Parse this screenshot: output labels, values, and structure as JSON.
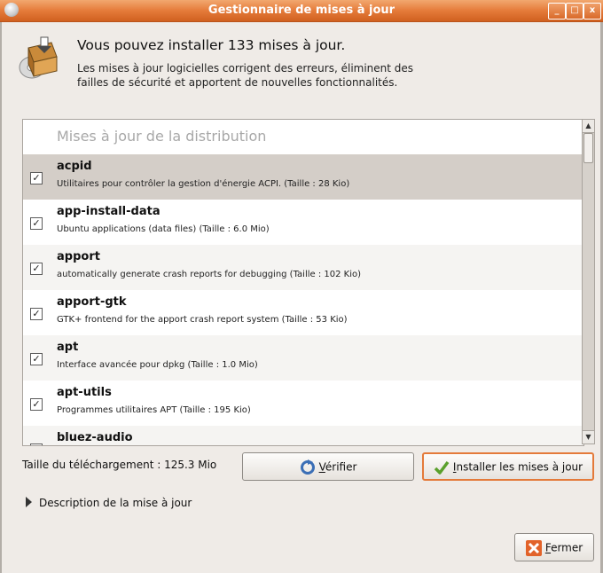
{
  "window": {
    "title": "Gestionnaire de mises à jour"
  },
  "header": {
    "title": "Vous pouvez installer 133 mises à jour.",
    "description": "Les mises à jour logicielles corrigent des erreurs, éliminent des failles de sécurité et apportent de nouvelles fonctionnalités."
  },
  "list": {
    "section_title": "Mises à jour de la distribution",
    "items": [
      {
        "name": "acpid",
        "description": "Utilitaires pour contrôler la gestion d'énergie ACPI. (Taille : 28 Kio)",
        "checked": true,
        "selected": true
      },
      {
        "name": "app-install-data",
        "description": "Ubuntu applications (data files) (Taille : 6.0 Mio)",
        "checked": true
      },
      {
        "name": "apport",
        "description": "automatically generate crash reports for debugging (Taille : 102 Kio)",
        "checked": true
      },
      {
        "name": "apport-gtk",
        "description": "GTK+ frontend for the apport crash report system (Taille : 53 Kio)",
        "checked": true
      },
      {
        "name": "apt",
        "description": "Interface avancée pour dpkg (Taille : 1.0 Mio)",
        "checked": true
      },
      {
        "name": "apt-utils",
        "description": "Programmes utilitaires APT (Taille : 195 Kio)",
        "checked": true
      },
      {
        "name": "bluez-audio",
        "description": "",
        "checked": true
      }
    ]
  },
  "footer": {
    "download_size": "Taille du téléchargement : 125.3 Mio",
    "verify_mnemonic": "V",
    "verify_rest": "érifier",
    "install_mnemonic": "I",
    "install_rest": "nstaller les mises à jour",
    "details_label": "Description de la mise à jour",
    "close_mnemonic": "F",
    "close_rest": "ermer"
  },
  "glyphs": {
    "check": "✓",
    "scroll_up": "▲",
    "scroll_down": "▼",
    "minimize": "_",
    "maximize": "□",
    "close": "x"
  },
  "colors": {
    "titlebar": "#e57b3a",
    "selection": "#d4cec8",
    "accent_border": "#e47a3a"
  }
}
